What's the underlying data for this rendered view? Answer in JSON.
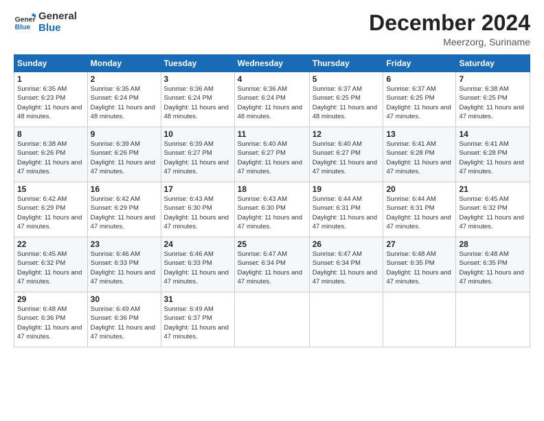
{
  "logo": {
    "general": "General",
    "blue": "Blue"
  },
  "header": {
    "month": "December 2024",
    "location": "Meerzorg, Suriname"
  },
  "weekdays": [
    "Sunday",
    "Monday",
    "Tuesday",
    "Wednesday",
    "Thursday",
    "Friday",
    "Saturday"
  ],
  "weeks": [
    [
      {
        "day": "1",
        "sunrise": "6:35 AM",
        "sunset": "6:23 PM",
        "daylight": "11 hours and 48 minutes."
      },
      {
        "day": "2",
        "sunrise": "6:35 AM",
        "sunset": "6:24 PM",
        "daylight": "11 hours and 48 minutes."
      },
      {
        "day": "3",
        "sunrise": "6:36 AM",
        "sunset": "6:24 PM",
        "daylight": "11 hours and 48 minutes."
      },
      {
        "day": "4",
        "sunrise": "6:36 AM",
        "sunset": "6:24 PM",
        "daylight": "11 hours and 48 minutes."
      },
      {
        "day": "5",
        "sunrise": "6:37 AM",
        "sunset": "6:25 PM",
        "daylight": "11 hours and 48 minutes."
      },
      {
        "day": "6",
        "sunrise": "6:37 AM",
        "sunset": "6:25 PM",
        "daylight": "11 hours and 47 minutes."
      },
      {
        "day": "7",
        "sunrise": "6:38 AM",
        "sunset": "6:25 PM",
        "daylight": "11 hours and 47 minutes."
      }
    ],
    [
      {
        "day": "8",
        "sunrise": "6:38 AM",
        "sunset": "6:26 PM",
        "daylight": "11 hours and 47 minutes."
      },
      {
        "day": "9",
        "sunrise": "6:39 AM",
        "sunset": "6:26 PM",
        "daylight": "11 hours and 47 minutes."
      },
      {
        "day": "10",
        "sunrise": "6:39 AM",
        "sunset": "6:27 PM",
        "daylight": "11 hours and 47 minutes."
      },
      {
        "day": "11",
        "sunrise": "6:40 AM",
        "sunset": "6:27 PM",
        "daylight": "11 hours and 47 minutes."
      },
      {
        "day": "12",
        "sunrise": "6:40 AM",
        "sunset": "6:27 PM",
        "daylight": "11 hours and 47 minutes."
      },
      {
        "day": "13",
        "sunrise": "6:41 AM",
        "sunset": "6:28 PM",
        "daylight": "11 hours and 47 minutes."
      },
      {
        "day": "14",
        "sunrise": "6:41 AM",
        "sunset": "6:28 PM",
        "daylight": "11 hours and 47 minutes."
      }
    ],
    [
      {
        "day": "15",
        "sunrise": "6:42 AM",
        "sunset": "6:29 PM",
        "daylight": "11 hours and 47 minutes."
      },
      {
        "day": "16",
        "sunrise": "6:42 AM",
        "sunset": "6:29 PM",
        "daylight": "11 hours and 47 minutes."
      },
      {
        "day": "17",
        "sunrise": "6:43 AM",
        "sunset": "6:30 PM",
        "daylight": "11 hours and 47 minutes."
      },
      {
        "day": "18",
        "sunrise": "6:43 AM",
        "sunset": "6:30 PM",
        "daylight": "11 hours and 47 minutes."
      },
      {
        "day": "19",
        "sunrise": "6:44 AM",
        "sunset": "6:31 PM",
        "daylight": "11 hours and 47 minutes."
      },
      {
        "day": "20",
        "sunrise": "6:44 AM",
        "sunset": "6:31 PM",
        "daylight": "11 hours and 47 minutes."
      },
      {
        "day": "21",
        "sunrise": "6:45 AM",
        "sunset": "6:32 PM",
        "daylight": "11 hours and 47 minutes."
      }
    ],
    [
      {
        "day": "22",
        "sunrise": "6:45 AM",
        "sunset": "6:32 PM",
        "daylight": "11 hours and 47 minutes."
      },
      {
        "day": "23",
        "sunrise": "6:46 AM",
        "sunset": "6:33 PM",
        "daylight": "11 hours and 47 minutes."
      },
      {
        "day": "24",
        "sunrise": "6:46 AM",
        "sunset": "6:33 PM",
        "daylight": "11 hours and 47 minutes."
      },
      {
        "day": "25",
        "sunrise": "6:47 AM",
        "sunset": "6:34 PM",
        "daylight": "11 hours and 47 minutes."
      },
      {
        "day": "26",
        "sunrise": "6:47 AM",
        "sunset": "6:34 PM",
        "daylight": "11 hours and 47 minutes."
      },
      {
        "day": "27",
        "sunrise": "6:48 AM",
        "sunset": "6:35 PM",
        "daylight": "11 hours and 47 minutes."
      },
      {
        "day": "28",
        "sunrise": "6:48 AM",
        "sunset": "6:35 PM",
        "daylight": "11 hours and 47 minutes."
      }
    ],
    [
      {
        "day": "29",
        "sunrise": "6:48 AM",
        "sunset": "6:36 PM",
        "daylight": "11 hours and 47 minutes."
      },
      {
        "day": "30",
        "sunrise": "6:49 AM",
        "sunset": "6:36 PM",
        "daylight": "11 hours and 47 minutes."
      },
      {
        "day": "31",
        "sunrise": "6:49 AM",
        "sunset": "6:37 PM",
        "daylight": "11 hours and 47 minutes."
      },
      null,
      null,
      null,
      null
    ]
  ],
  "labels": {
    "sunrise": "Sunrise:",
    "sunset": "Sunset:",
    "daylight": "Daylight:"
  }
}
